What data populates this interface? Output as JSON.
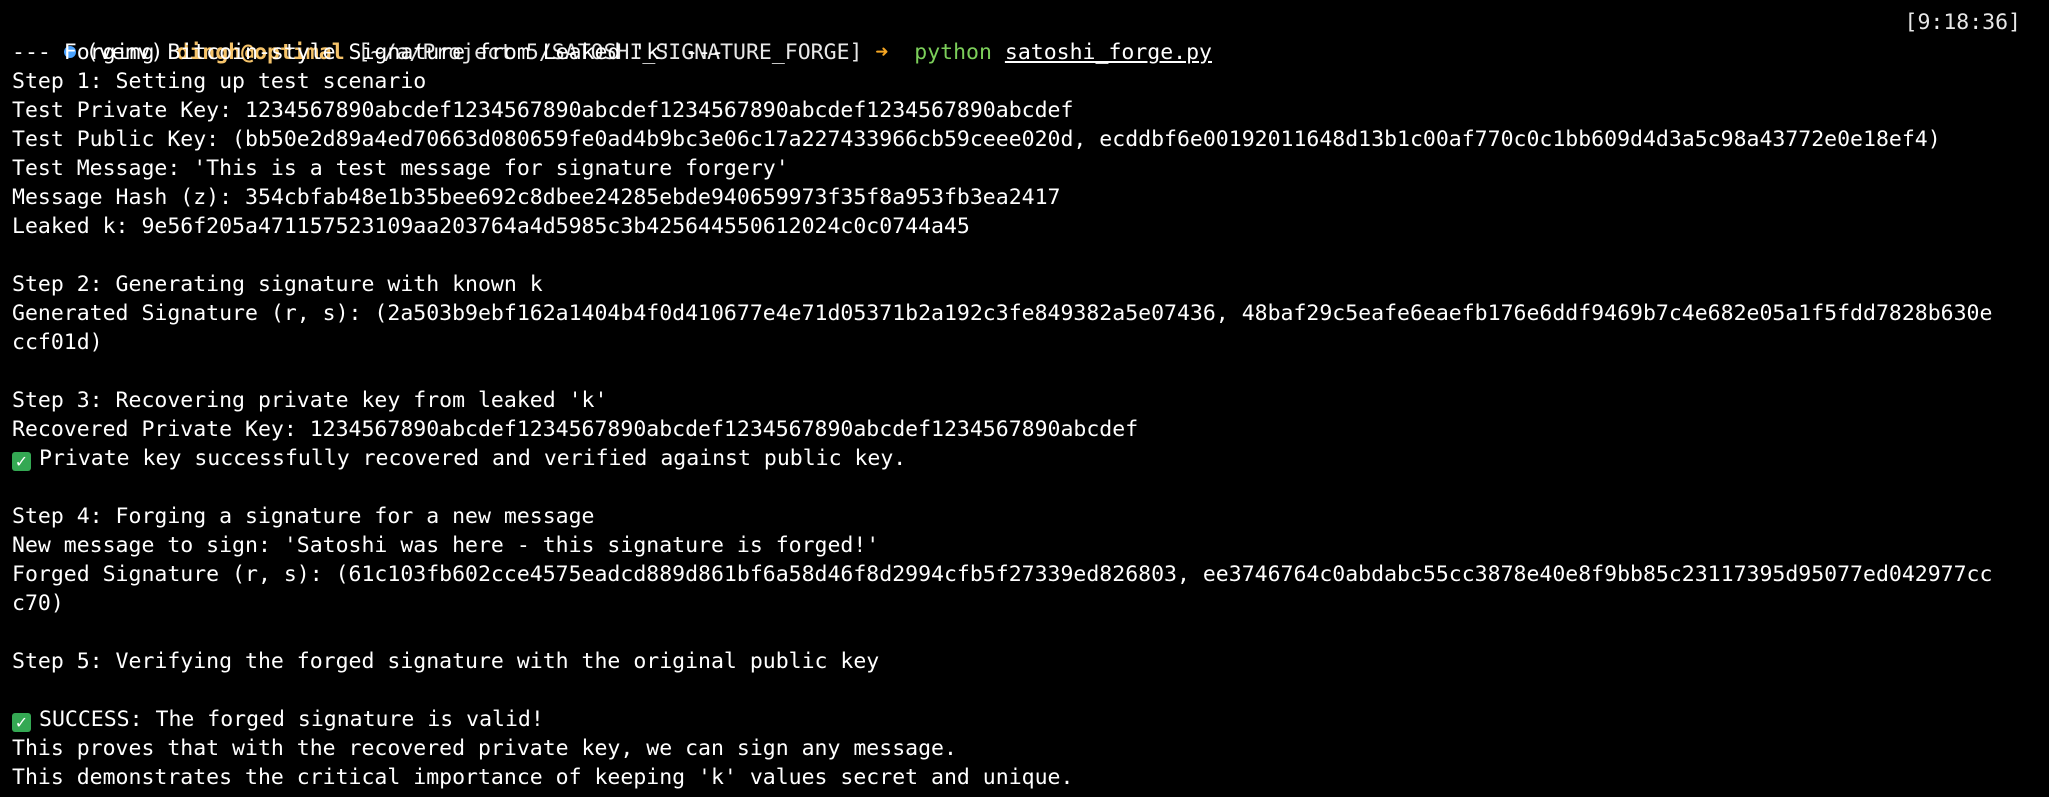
{
  "prompt": {
    "venv": "(venv)",
    "user_host": "dingh@optimal",
    "cwd": "[~/a/Project 5/SATOSHI_SIGNATURE_FORGE]",
    "arrow": "➜",
    "command": "python",
    "argument": "satoshi_forge.py",
    "time": "[9:18:36]"
  },
  "output": {
    "header": "--- Forging Bitcoin-style Signature from Leaked 'k' ---",
    "step1": "Step 1: Setting up test scenario",
    "priv_key": "Test Private Key: 1234567890abcdef1234567890abcdef1234567890abcdef1234567890abcdef",
    "pub_key": "Test Public Key: (bb50e2d89a4ed70663d080659fe0ad4b9bc3e06c17a227433966cb59ceee020d, ecddbf6e00192011648d13b1c00af770c0c1bb609d4d3a5c98a43772e0e18ef4)",
    "message": "Test Message: 'This is a test message for signature forgery'",
    "hash": "Message Hash (z): 354cbfab48e1b35bee692c8dbee24285ebde940659973f35f8a953fb3ea2417",
    "leaked_k": "Leaked k: 9e56f205a471157523109aa203764a4d5985c3b425644550612024c0c0744a45",
    "step2": "Step 2: Generating signature with known k",
    "gen_sig_1": "Generated Signature (r, s): (2a503b9ebf162a1404b4f0d410677e4e71d05371b2a192c3fe849382a5e07436, 48baf29c5eafe6eaefb176e6ddf9469b7c4e682e05a1f5fdd7828b630e",
    "gen_sig_2": "ccf01d)",
    "step3": "Step 3: Recovering private key from leaked 'k'",
    "recovered": "Recovered Private Key: 1234567890abcdef1234567890abcdef1234567890abcdef1234567890abcdef",
    "recovered_ok": "Private key successfully recovered and verified against public key.",
    "step4": "Step 4: Forging a signature for a new message",
    "new_msg": "New message to sign: 'Satoshi was here - this signature is forged!'",
    "forged_1": "Forged Signature (r, s): (61c103fb602cce4575eadcd889d861bf6a58d46f8d2994cfb5f27339ed826803, ee3746764c0abdabc55cc3878e40e8f9bb85c23117395d95077ed042977cc",
    "forged_2": "c70)",
    "step5": "Step 5: Verifying the forged signature with the original public key",
    "success": "SUCCESS: The forged signature is valid!",
    "proves": "This proves that with the recovered private key, we can sign any message.",
    "demonstrates": "This demonstrates the critical importance of keeping 'k' values secret and unique."
  },
  "icons": {
    "status_dot": "circle-dot-icon",
    "check": "check-mark-icon"
  },
  "colors": {
    "background": "#000000",
    "text": "#ffffff",
    "prompt_user": "#f5c36a",
    "command": "#7ccf5a",
    "arrow": "#f5a623",
    "dot": "#4aa3ff",
    "check": "#34a853"
  }
}
